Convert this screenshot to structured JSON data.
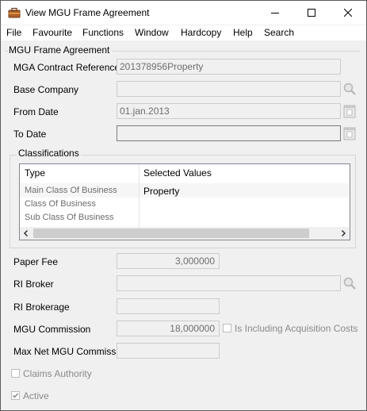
{
  "window": {
    "title": "View MGU Frame Agreement",
    "icons": {
      "app": "briefcase-icon",
      "minimize": "minimize-icon",
      "maximize": "maximize-icon",
      "close": "close-icon"
    }
  },
  "menu": [
    "File",
    "Favourite",
    "Functions",
    "Window",
    "Hardcopy",
    "Help",
    "Search"
  ],
  "group_title": "MGU Frame Agreement",
  "fields": {
    "contract_ref": {
      "label": "MGA Contract Reference",
      "value": "201378956Property"
    },
    "base_company": {
      "label": "Base Company",
      "value": ""
    },
    "from_date": {
      "label": "From Date",
      "value": "01.jan.2013"
    },
    "to_date": {
      "label": "To Date",
      "value": ""
    },
    "paper_fee": {
      "label": "Paper Fee",
      "value": "3,000000"
    },
    "ri_broker": {
      "label": "RI Broker",
      "value": ""
    },
    "ri_brokerage": {
      "label": "RI Brokerage",
      "value": ""
    },
    "mgu_commission": {
      "label": "MGU Commission",
      "value": "18,000000"
    },
    "max_net_mgu_commission": {
      "label": "Max Net MGU Commission",
      "value": ""
    }
  },
  "classifications": {
    "legend": "Classifications",
    "columns": [
      "Type",
      "Selected Values"
    ],
    "rows": [
      {
        "type": "Main Class Of Business",
        "value": "Property"
      },
      {
        "type": "Class Of Business",
        "value": ""
      },
      {
        "type": "Sub Class Of Business",
        "value": ""
      }
    ]
  },
  "checkboxes": {
    "including_acquisition_costs": {
      "label": "Is Including Acquisition Costs",
      "checked": false
    },
    "claims_authority": {
      "label": "Claims Authority",
      "checked": false
    },
    "active": {
      "label": "Active",
      "checked": true
    }
  },
  "colors": {
    "border": "#cccccc",
    "disabled_text": "#6d6d6d",
    "grid_border": "#828790"
  }
}
